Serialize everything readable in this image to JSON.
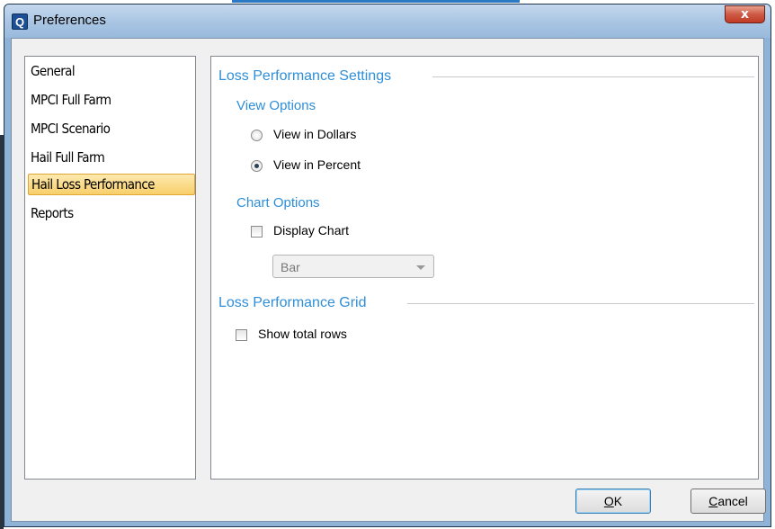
{
  "window": {
    "title": "Preferences",
    "icon": "Q",
    "close_glyph": "x"
  },
  "nav": {
    "items": [
      {
        "label": "General"
      },
      {
        "label": "MPCI Full Farm"
      },
      {
        "label": "MPCI Scenario"
      },
      {
        "label": "Hail Full Farm"
      },
      {
        "label": "Hail Loss Performance",
        "selected": true
      },
      {
        "label": "Reports"
      }
    ]
  },
  "loss_performance_settings": {
    "title": "Loss Performance Settings",
    "view_options": {
      "title": "View Options",
      "dollars_label": "View in Dollars",
      "percent_label": "View in Percent",
      "selected": "View in Percent"
    },
    "chart_options": {
      "title": "Chart Options",
      "display_chart_label": "Display Chart",
      "display_chart_checked": false,
      "chart_type": "Bar"
    }
  },
  "loss_performance_grid": {
    "title": "Loss Performance Grid",
    "show_total_rows_label": "Show total rows",
    "show_total_rows_checked": false
  },
  "buttons": {
    "ok_mnemonic": "O",
    "ok_rest": "K",
    "cancel_mnemonic": "C",
    "cancel_rest": "ancel"
  },
  "colors": {
    "section_title": "#2e8ed8",
    "selected_item": "#f8cf6a",
    "title_bar": "#a8c4e2",
    "close_button": "#c23b24"
  }
}
